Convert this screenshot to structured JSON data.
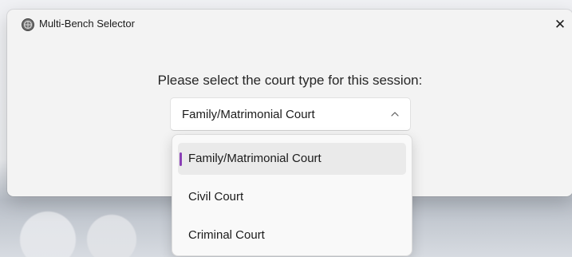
{
  "window": {
    "title": "Multi-Bench Selector",
    "close_label": "✕"
  },
  "dialog": {
    "prompt": "Please select the court type for this session:"
  },
  "court_select": {
    "selected_value": "Family/Matrimonial Court",
    "expanded": true,
    "options": [
      {
        "label": "Family/Matrimonial Court",
        "selected": true
      },
      {
        "label": "Civil Court",
        "selected": false
      },
      {
        "label": "Criminal Court",
        "selected": false
      }
    ]
  },
  "colors": {
    "accent": "#8a3fb5",
    "dialog_background": "#f3f3f3",
    "selected_option_background": "#eaeaea"
  },
  "icons": {
    "app": "app-logo-icon",
    "close": "close-icon",
    "chevron": "chevron-up-icon"
  }
}
